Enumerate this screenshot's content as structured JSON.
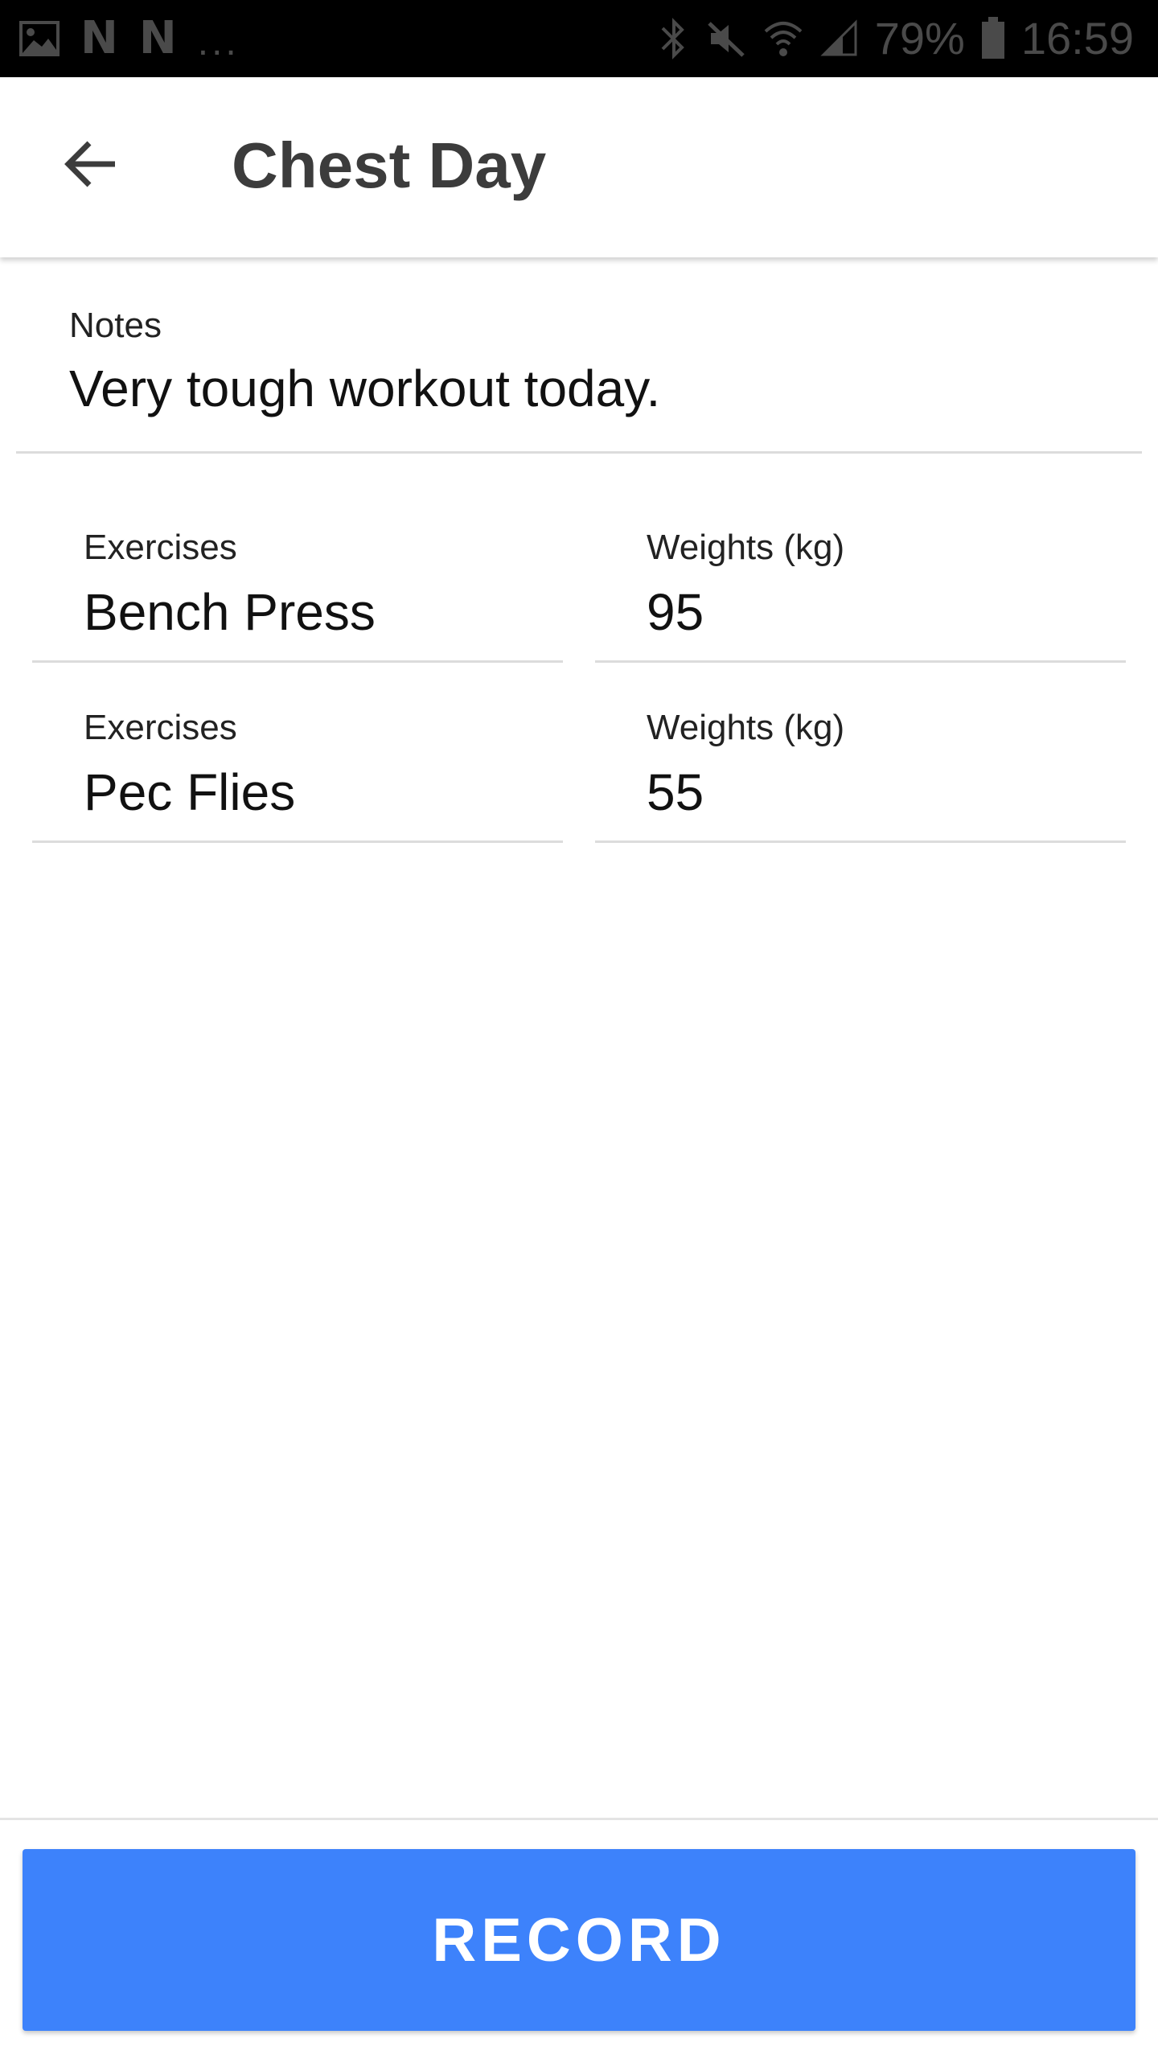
{
  "status_bar": {
    "battery": "79%",
    "time": "16:59",
    "left_icons": [
      "gallery-icon",
      "n-app-icon",
      "n-app-icon",
      "more-dots"
    ],
    "right_icons": [
      "bluetooth-icon",
      "mute-icon",
      "wifi-icon",
      "signal-icon",
      "battery-icon"
    ]
  },
  "app_bar": {
    "title": "Chest Day",
    "back_icon": "arrow-back-icon"
  },
  "notes": {
    "label": "Notes",
    "value": "Very tough workout today."
  },
  "exercises": [
    {
      "exercise_label": "Exercises",
      "exercise_value": "Bench Press",
      "weight_label": "Weights (kg)",
      "weight_value": "95"
    },
    {
      "exercise_label": "Exercises",
      "exercise_value": "Pec Flies",
      "weight_label": "Weights (kg)",
      "weight_value": "55"
    }
  ],
  "record_button": {
    "label": "RECORD"
  },
  "colors": {
    "accent": "#3d82fb",
    "status_bar_bg": "#000000",
    "title_text": "#3c3c3c",
    "divider": "#dcdcdc"
  }
}
